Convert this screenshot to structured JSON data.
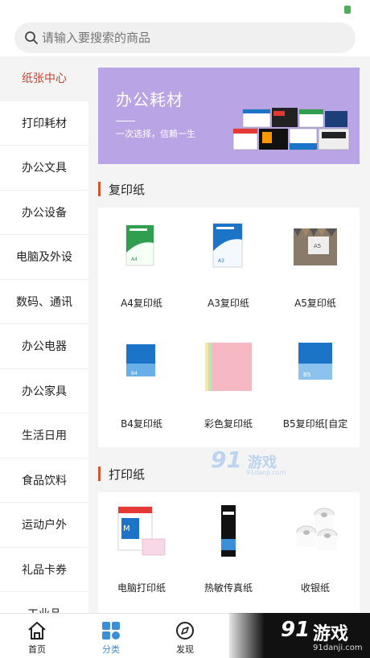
{
  "search": {
    "placeholder": "请输入要搜索的商品"
  },
  "sidebar": {
    "items": [
      {
        "label": "纸张中心",
        "active": true
      },
      {
        "label": "打印耗材",
        "active": false
      },
      {
        "label": "办公文具",
        "active": false
      },
      {
        "label": "办公设备",
        "active": false
      },
      {
        "label": "电脑及外设",
        "active": false
      },
      {
        "label": "数码、通讯",
        "active": false
      },
      {
        "label": "办公电器",
        "active": false
      },
      {
        "label": "办公家具",
        "active": false
      },
      {
        "label": "生活日用",
        "active": false
      },
      {
        "label": "食品饮料",
        "active": false
      },
      {
        "label": "运动户外",
        "active": false
      },
      {
        "label": "礼品卡券",
        "active": false
      },
      {
        "label": "工业品",
        "active": false
      }
    ]
  },
  "banner": {
    "title": "办公耗材",
    "subtitle": "一次选择，信赖一生"
  },
  "sections": [
    {
      "title": "复印纸",
      "products": [
        "A4复印纸",
        "A3复印纸",
        "A5复印纸",
        "B4复印纸",
        "彩色复印纸",
        "B5复印纸[自定"
      ]
    },
    {
      "title": "打印纸",
      "products": [
        "电脑打印纸",
        "热敏传真纸",
        "收银纸"
      ]
    }
  ],
  "watermark": {
    "number": "91",
    "text": "游戏",
    "url": "91danji.com"
  },
  "bottom_nav": [
    {
      "label": "首页",
      "icon": "home-icon",
      "active": false
    },
    {
      "label": "分类",
      "icon": "category-grid-icon",
      "active": true
    },
    {
      "label": "发现",
      "icon": "discover-compass-icon",
      "active": false
    }
  ],
  "colors": {
    "accent": "#c6442b",
    "section_bar": "#d2572f",
    "nav_active": "#3b8ed8",
    "banner_bg": "#b9a4e6"
  }
}
